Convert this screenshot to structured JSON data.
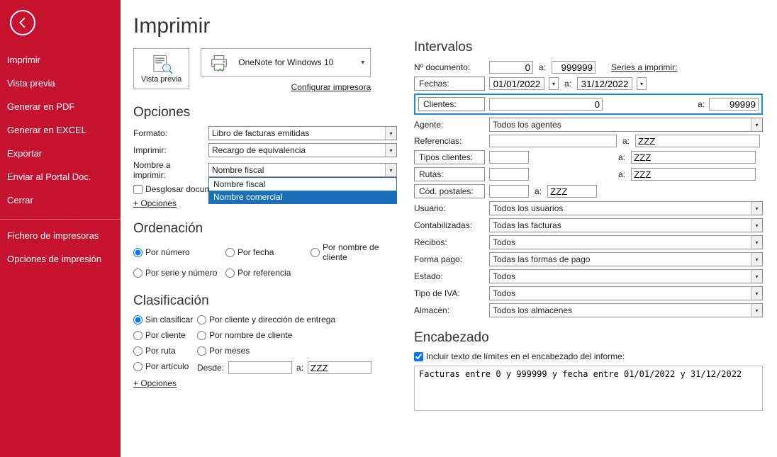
{
  "sidebar": {
    "items": [
      {
        "label": "Imprimir"
      },
      {
        "label": "Vista previa"
      },
      {
        "label": "Generar en PDF"
      },
      {
        "label": "Generar en EXCEL"
      },
      {
        "label": "Exportar"
      },
      {
        "label": "Enviar al Portal Doc."
      },
      {
        "label": "Cerrar"
      }
    ],
    "bottom": [
      {
        "label": "Fichero de impresoras"
      },
      {
        "label": "Opciones de impresión"
      }
    ]
  },
  "title": "Imprimir",
  "top": {
    "preview_label": "Vista previa",
    "printer_name": "OneNote for Windows 10",
    "configure": "Configurar impresora"
  },
  "opciones": {
    "title": "Opciones",
    "formato_label": "Formato:",
    "formato_value": "Libro de facturas emitidas",
    "imprimir_label": "Imprimir:",
    "imprimir_value": "Recargo de equivalencia",
    "nombre_label": "Nombre a imprimir:",
    "nombre_value": "Nombre fiscal",
    "nombre_opts": [
      "Nombre fiscal",
      "Nombre comercial"
    ],
    "desglosar": "Desglosar docum",
    "opciones_link": "+ Opciones"
  },
  "ordenacion": {
    "title": "Ordenación",
    "opts": [
      "Por número",
      "Por fecha",
      "Por nombre de cliente",
      "Por serie y número",
      "Por referencia"
    ]
  },
  "clasificacion": {
    "title": "Clasificación",
    "opts": [
      "Sin clasificar",
      "Por cliente y dirección de entrega",
      "Por cliente",
      "Por nombre de cliente",
      "Por ruta",
      "Por meses",
      "Por artículo"
    ],
    "desde": "Desde:",
    "a": "a:",
    "a_value": "ZZZ",
    "opciones_link": "+ Opciones"
  },
  "intervalos": {
    "title": "Intervalos",
    "ndoc_label": "Nº documento:",
    "ndoc_from": "0",
    "ndoc_to": "999999",
    "series_link": "Series a imprimir:",
    "fechas_label": "Fechas:",
    "fecha_from": "01/01/2022",
    "fecha_to": "31/12/2022",
    "clientes_label": "Clientes:",
    "clientes_from": "0",
    "clientes_to": "99999",
    "agente_label": "Agente:",
    "agente_value": "Todos los agentes",
    "ref_label": "Referencias:",
    "ref_to": "ZZZ",
    "tipos_label": "Tipos clientes:",
    "tipos_to": "ZZZ",
    "rutas_label": "Rutas:",
    "rutas_to": "ZZZ",
    "cod_label": "Cód. postales:",
    "cod_to": "ZZZ",
    "usuario_label": "Usuario:",
    "usuario_value": "Todos los usuarios",
    "contab_label": "Contabilizadas:",
    "contab_value": "Todas las facturas",
    "recibos_label": "Recibos:",
    "recibos_value": "Todos",
    "forma_label": "Forma pago:",
    "forma_value": "Todas las formas de pago",
    "estado_label": "Estado:",
    "estado_value": "Todos",
    "tipoiva_label": "Tipo de IVA:",
    "tipoiva_value": "Todos",
    "almacen_label": "Almacén:",
    "almacen_value": "Todos los almacenes",
    "a": "a:"
  },
  "encabezado": {
    "title": "Encabezado",
    "incluir": "Incluir texto de límites en el encabezado del informe:",
    "text": "Facturas entre 0 y 999999 y fecha entre 01/01/2022 y 31/12/2022"
  }
}
